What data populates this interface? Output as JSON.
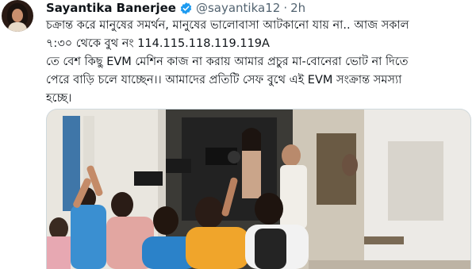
{
  "author": {
    "name": "Sayantika Banerjee",
    "handle": "@sayantika12",
    "separator": "·",
    "time": "2h"
  },
  "tweet": {
    "lines": [
      "চক্রান্ত করে মানুষের সমর্থন, মানুষের ভালোবাসা আটকানো যায় না.. আজ সকাল",
      "৭:৩০  থেকে বুথ নং  114.115.118.119.119A",
      "তে বেশ কিছু EVM মেশিন কাজ না করায় আমার প্রচুর মা-বোনেরা ভোট না দিতে",
      "পেরে বাড়ি চলে যাচ্ছেন।। আমাদের প্রতিটি সেফ বুথে এই EVM সংক্রান্ত সমস্যা",
      "হচ্ছে।"
    ]
  },
  "colors": {
    "verified": "#1d9bf0",
    "secondary_text": "#536471",
    "border": "#cfd9de"
  },
  "icons": {
    "verified": "verified-badge-icon"
  }
}
